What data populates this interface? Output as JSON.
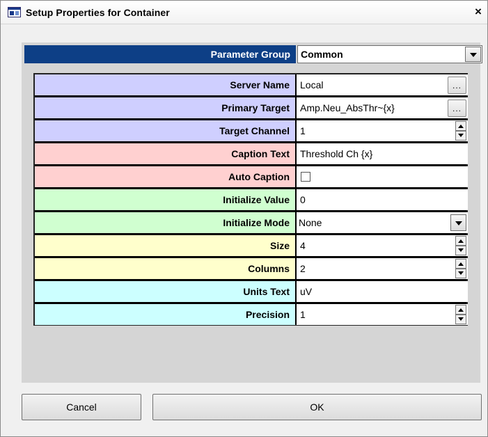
{
  "window": {
    "title": "Setup Properties for Container",
    "close_glyph": "×",
    "app_icon": "window-icon"
  },
  "parameter_group": {
    "label": "Parameter Group",
    "selected": "Common"
  },
  "colors": {
    "header_bg": "#0d3f86",
    "server_group": "#cfcfff",
    "caption_group": "#ffd0d0",
    "initialize_group": "#d0ffd0",
    "size_group": "#ffffcc",
    "units_group": "#ccffff"
  },
  "properties": [
    {
      "label": "Server Name",
      "value": "Local",
      "control": "ellipsis",
      "button_label": "...",
      "color": "#cfcfff"
    },
    {
      "label": "Primary Target",
      "value": "Amp.Neu_AbsThr~{x}",
      "control": "ellipsis",
      "button_label": "...",
      "color": "#cfcfff"
    },
    {
      "label": "Target Channel",
      "value": "1",
      "control": "spinner",
      "color": "#cfcfff"
    },
    {
      "label": "Caption Text",
      "value": "Threshold Ch {x}",
      "control": "text",
      "color": "#ffd0d0"
    },
    {
      "label": "Auto Caption",
      "value": "",
      "checked": false,
      "control": "checkbox",
      "color": "#ffd0d0"
    },
    {
      "label": "Initialize Value",
      "value": "0",
      "control": "text",
      "color": "#d0ffd0"
    },
    {
      "label": "Initialize Mode",
      "value": "None",
      "control": "dropdown",
      "color": "#d0ffd0"
    },
    {
      "label": "Size",
      "value": "4",
      "control": "spinner",
      "color": "#ffffcc"
    },
    {
      "label": "Columns",
      "value": "2",
      "control": "spinner",
      "color": "#ffffcc"
    },
    {
      "label": "Units Text",
      "value": "uV",
      "control": "text",
      "color": "#ccffff"
    },
    {
      "label": "Precision",
      "value": "1",
      "control": "spinner",
      "color": "#ccffff"
    }
  ],
  "buttons": {
    "cancel": "Cancel",
    "ok": "OK"
  }
}
